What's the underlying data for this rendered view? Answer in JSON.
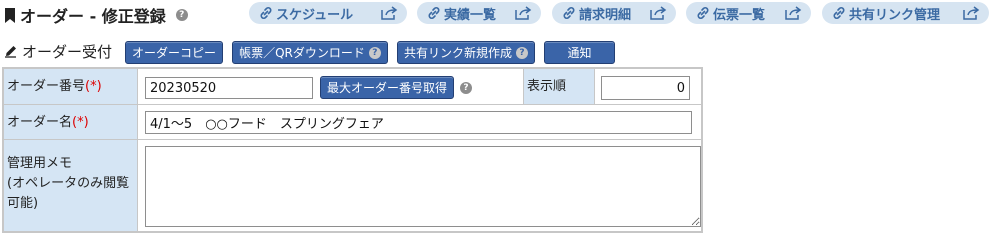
{
  "header": {
    "title": "オーダー - 修正登録",
    "nav": [
      {
        "label": "スケジュール"
      },
      {
        "label": "実績一覧"
      },
      {
        "label": "請求明細"
      },
      {
        "label": "伝票一覧"
      },
      {
        "label": "共有リンク管理"
      }
    ]
  },
  "toolbar": {
    "section_label": "オーダー受付",
    "copy_label": "オーダーコピー",
    "download_label": "帳票／QRダウンロード",
    "share_label": "共有リンク新規作成",
    "notify_label": "通知"
  },
  "form": {
    "order_number": {
      "label": "オーダー番号",
      "required_mark": "(*)",
      "value": "20230520",
      "fetch_label": "最大オーダー番号取得"
    },
    "display_order": {
      "label": "表示順",
      "value": "0"
    },
    "order_name": {
      "label": "オーダー名",
      "required_mark": "(*)",
      "value": "4/1～5　○○フード　スプリングフェア"
    },
    "memo": {
      "label": "管理用メモ\n(オペレータのみ閲覧可能)",
      "value": ""
    }
  },
  "colors": {
    "accent": "#3a64a8",
    "nav_bg": "#d6e4f1",
    "label_bg": "#d5e5f4",
    "required": "#dd0000"
  }
}
